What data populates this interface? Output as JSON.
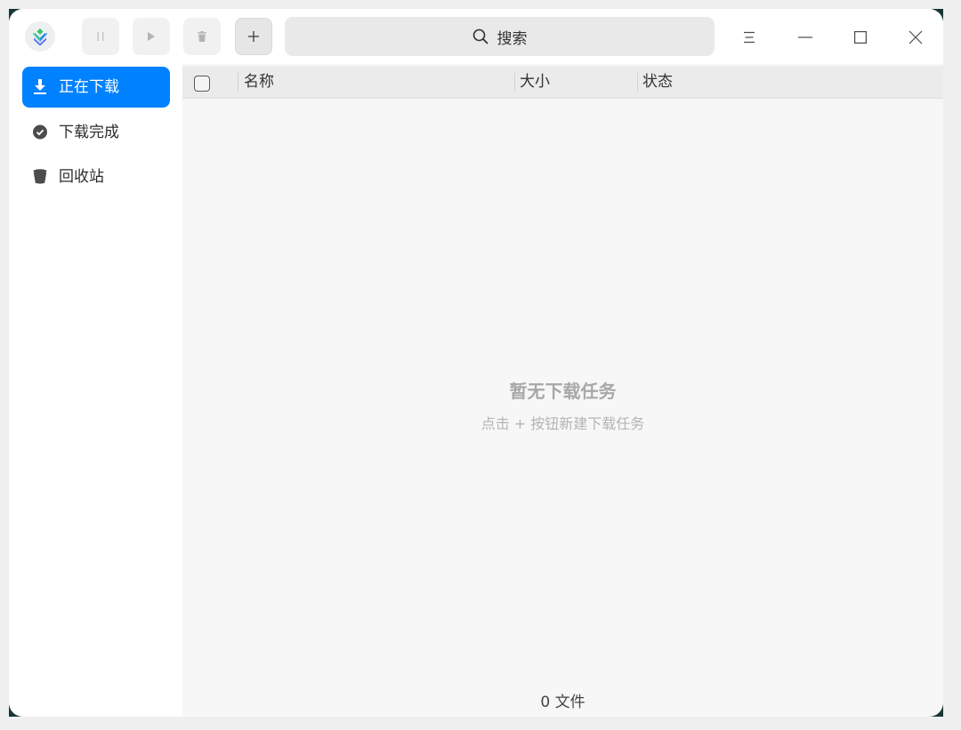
{
  "app": {
    "icon": "app-logo-icon"
  },
  "toolbar": {
    "pause": {
      "icon": "pause-icon",
      "enabled": false
    },
    "start": {
      "icon": "play-icon",
      "enabled": false
    },
    "delete": {
      "icon": "trash-icon",
      "enabled": false
    },
    "new_task": {
      "icon": "plus-icon",
      "enabled": true
    }
  },
  "search": {
    "placeholder": "搜索",
    "icon": "search-icon"
  },
  "window_controls": {
    "menu": "menu-icon",
    "minimize": "minimize-icon",
    "maximize": "maximize-icon",
    "close": "close-icon"
  },
  "sidebar": {
    "items": [
      {
        "label": "正在下载",
        "icon": "download-icon",
        "selected": true
      },
      {
        "label": "下载完成",
        "icon": "check-circle-icon",
        "selected": false
      },
      {
        "label": "回收站",
        "icon": "trash-icon",
        "selected": false
      }
    ]
  },
  "table": {
    "select_all_checked": false,
    "columns": [
      {
        "label": "名称"
      },
      {
        "label": "大小"
      },
      {
        "label": "状态"
      }
    ],
    "rows": []
  },
  "empty_state": {
    "title": "暂无下载任务",
    "hint": "点击 + 按钮新建下载任务"
  },
  "footer": {
    "file_count": "0 文件"
  },
  "colors": {
    "accent": "#0081ff",
    "window_bg": "#ffffff",
    "content_bg": "#f7f7f8",
    "header_bg": "#ebebec",
    "muted_text": "#a8a8a8"
  }
}
